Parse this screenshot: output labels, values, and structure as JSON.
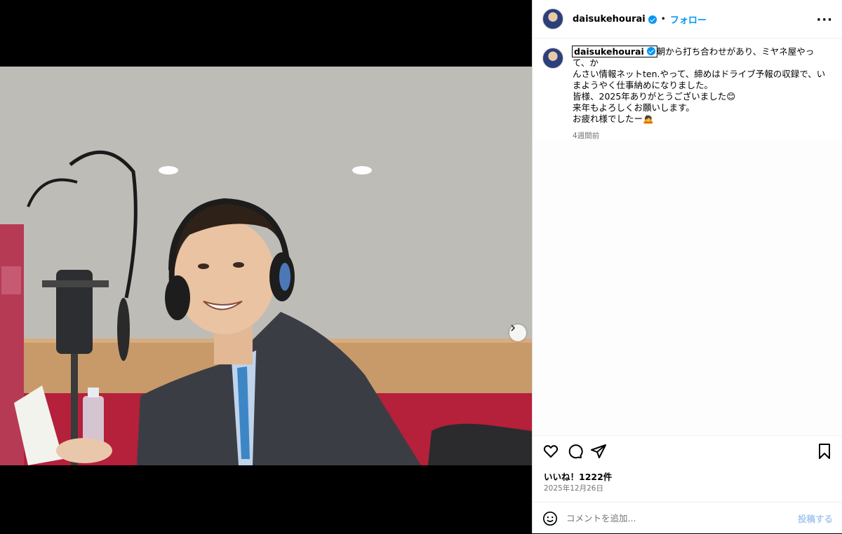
{
  "post": {
    "username": "daisukehourai",
    "follow_label": "フォロー",
    "separator": "•",
    "more_label": "···",
    "caption_lines": [
      "朝から打ち合わせがあり、ミヤネ屋やって、か",
      "んさい情報ネットten.やって、締めはドライブ予報の収録で、い",
      "まようやく仕事納めになりました。",
      "皆様、2025年ありがとうございました😊",
      "来年もよろしくお願いします。",
      "お疲れ様でしたー🙇"
    ],
    "time_ago": "4週間前",
    "likes": "いいね！1222件",
    "date": "2025年12月26日",
    "comment_placeholder": "コメントを追加...",
    "post_button": "投稿する"
  },
  "carousel": {
    "slide_count": 2,
    "active_slide": 1
  },
  "colors": {
    "accent": "#0095f6",
    "muted": "#737373"
  },
  "icons": [
    "verified-badge-icon",
    "more-options-icon",
    "next-arrow-icon",
    "heart-icon",
    "comment-icon",
    "share-icon",
    "bookmark-icon",
    "emoji-icon"
  ]
}
